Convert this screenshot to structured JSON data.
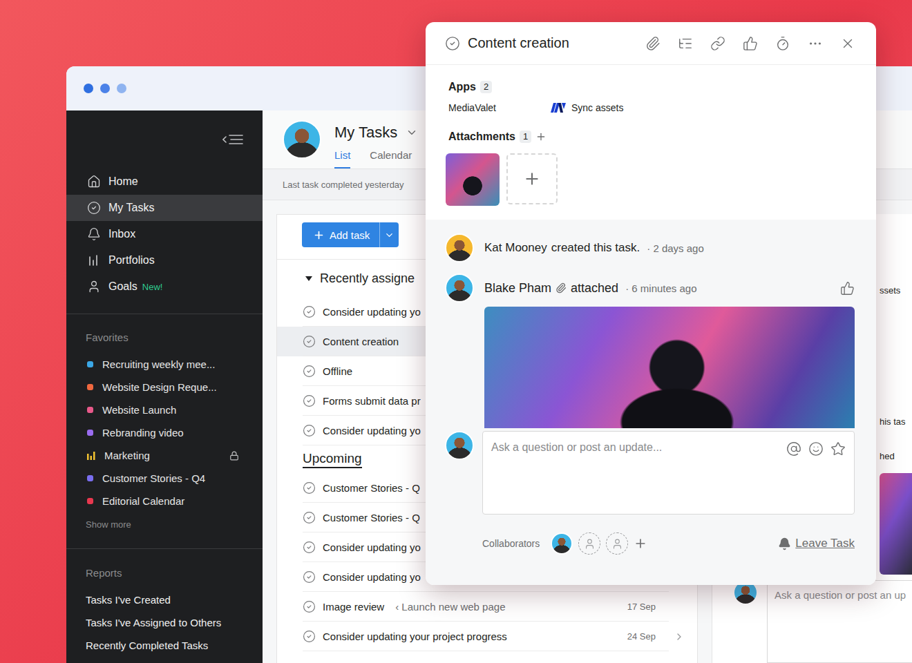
{
  "sidebar": {
    "nav": [
      {
        "label": "Home",
        "selected": false
      },
      {
        "label": "My Tasks",
        "selected": true
      },
      {
        "label": "Inbox",
        "selected": false
      },
      {
        "label": "Portfolios",
        "selected": false
      },
      {
        "label": "Goals",
        "selected": false,
        "badge": "New!"
      }
    ],
    "favorites": {
      "title": "Favorites",
      "items": [
        {
          "label": "Recruiting weekly mee...",
          "color": "#3ba7e6",
          "kind": "dot",
          "locked": false
        },
        {
          "label": "Website Design Reque...",
          "color": "#f0683f",
          "kind": "dot",
          "locked": false
        },
        {
          "label": "Website Launch",
          "color": "#e8598a",
          "kind": "dot",
          "locked": false
        },
        {
          "label": "Rebranding video",
          "color": "#9a6cf0",
          "kind": "dot",
          "locked": false
        },
        {
          "label": "Marketing",
          "color": "#f2c230",
          "kind": "bars",
          "locked": true
        },
        {
          "label": "Customer Stories - Q4",
          "color": "#7a6ef0",
          "kind": "dot",
          "locked": false
        },
        {
          "label": "Editorial Calendar",
          "color": "#e8384f",
          "kind": "dot",
          "locked": false
        }
      ],
      "more": "Show more"
    },
    "reports": {
      "title": "Reports",
      "items": [
        "Tasks I've Created",
        "Tasks I've Assigned to Others",
        "Recently Completed Tasks"
      ]
    }
  },
  "header": {
    "title": "My Tasks",
    "tabs": [
      {
        "label": "List",
        "selected": true
      },
      {
        "label": "Calendar",
        "selected": false
      }
    ],
    "status": "Last task completed yesterday"
  },
  "list": {
    "add_button": "Add task",
    "sections": [
      {
        "title": "Recently assigne",
        "kind": "toggle",
        "expanded": true,
        "tasks": [
          {
            "name": "Consider updating yo",
            "selected": false,
            "hovered": false
          },
          {
            "name": "Content creation",
            "selected": true,
            "hovered": false
          },
          {
            "name": "Offline",
            "selected": false,
            "hovered": false
          },
          {
            "name": "Forms submit data pr",
            "selected": false,
            "hovered": false
          },
          {
            "name": "Consider updating yo",
            "selected": false,
            "hovered": false
          }
        ]
      },
      {
        "title": "Upcoming",
        "kind": "plain",
        "expanded": true,
        "tasks": [
          {
            "name": "Customer Stories - Q",
            "selected": false,
            "hovered": false
          },
          {
            "name": "Customer Stories - Q",
            "selected": false,
            "hovered": false
          },
          {
            "name": "Consider updating yo",
            "selected": false,
            "hovered": false
          },
          {
            "name": "Consider updating yo",
            "selected": false,
            "hovered": false
          },
          {
            "name": "Image review",
            "project": "‹ Launch new web page",
            "due": "17 Sep",
            "selected": false,
            "hovered": false
          },
          {
            "name": "Consider updating your project progress",
            "due": "24 Sep",
            "selected": false,
            "hovered": true
          }
        ]
      }
    ]
  },
  "backdrop_pane": {
    "fragments": [
      "ssets",
      "his tas",
      "hed"
    ],
    "composer_placeholder": "Ask a question or post an up"
  },
  "task_detail": {
    "title": "Content creation",
    "completed": false,
    "apps": {
      "title": "Apps",
      "count": "2",
      "items": [
        {
          "name": "MediaValet",
          "action": "Sync assets"
        }
      ]
    },
    "attachments": {
      "title": "Attachments",
      "count": "1"
    },
    "feed": [
      {
        "author": "Kat Mooney",
        "action": "created this task.",
        "time": "· 2 days ago",
        "color": "#f5b82e",
        "attachment": false,
        "liked": false
      },
      {
        "author": "Blake Pham",
        "action": "attached",
        "time": "· 6 minutes ago",
        "color": "#3db5e6",
        "attachment": true,
        "liked": false
      }
    ],
    "composer": {
      "placeholder": "Ask a question or post an update..."
    },
    "collaborators": {
      "label": "Collaborators",
      "people": [
        {
          "kind": "avatar"
        },
        {
          "kind": "empty"
        },
        {
          "kind": "empty"
        }
      ]
    },
    "leave": "Leave Task"
  }
}
